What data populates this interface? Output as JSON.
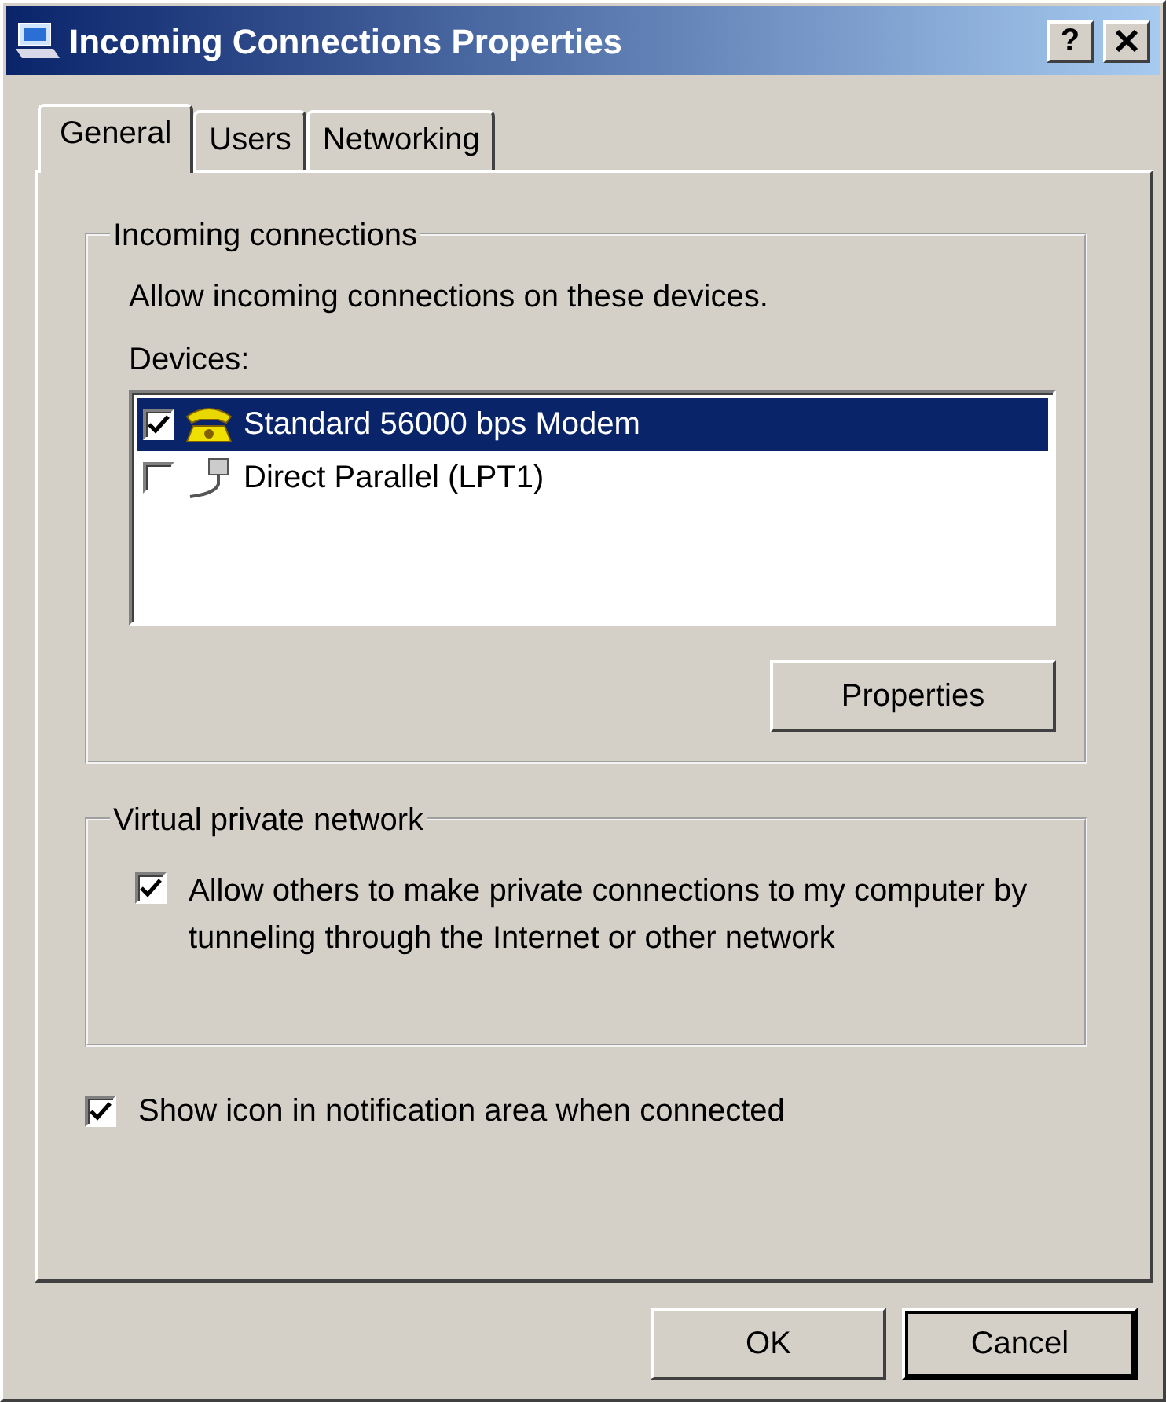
{
  "window": {
    "title": "Incoming Connections Properties",
    "help_button": "?"
  },
  "tabs": [
    {
      "label": "General",
      "selected": true
    },
    {
      "label": "Users",
      "selected": false
    },
    {
      "label": "Networking",
      "selected": false
    }
  ],
  "incoming": {
    "title": "Incoming connections",
    "description": "Allow incoming connections on these devices.",
    "devices_label": "Devices:",
    "devices": [
      {
        "name": "Standard 56000 bps Modem",
        "kind": "modem",
        "checked": true,
        "selected": true
      },
      {
        "name": "Direct Parallel (LPT1)",
        "kind": "cable",
        "checked": false,
        "selected": false
      }
    ],
    "properties_button": "Properties"
  },
  "vpn": {
    "title": "Virtual private network",
    "option": {
      "label": "Allow others to make private connections to my computer by tunneling through the Internet or other network",
      "checked": true
    }
  },
  "notify": {
    "label": "Show icon in notification area when connected",
    "checked": true
  },
  "buttons": [
    {
      "label": "OK",
      "default": false
    },
    {
      "label": "Cancel",
      "default": true
    }
  ]
}
